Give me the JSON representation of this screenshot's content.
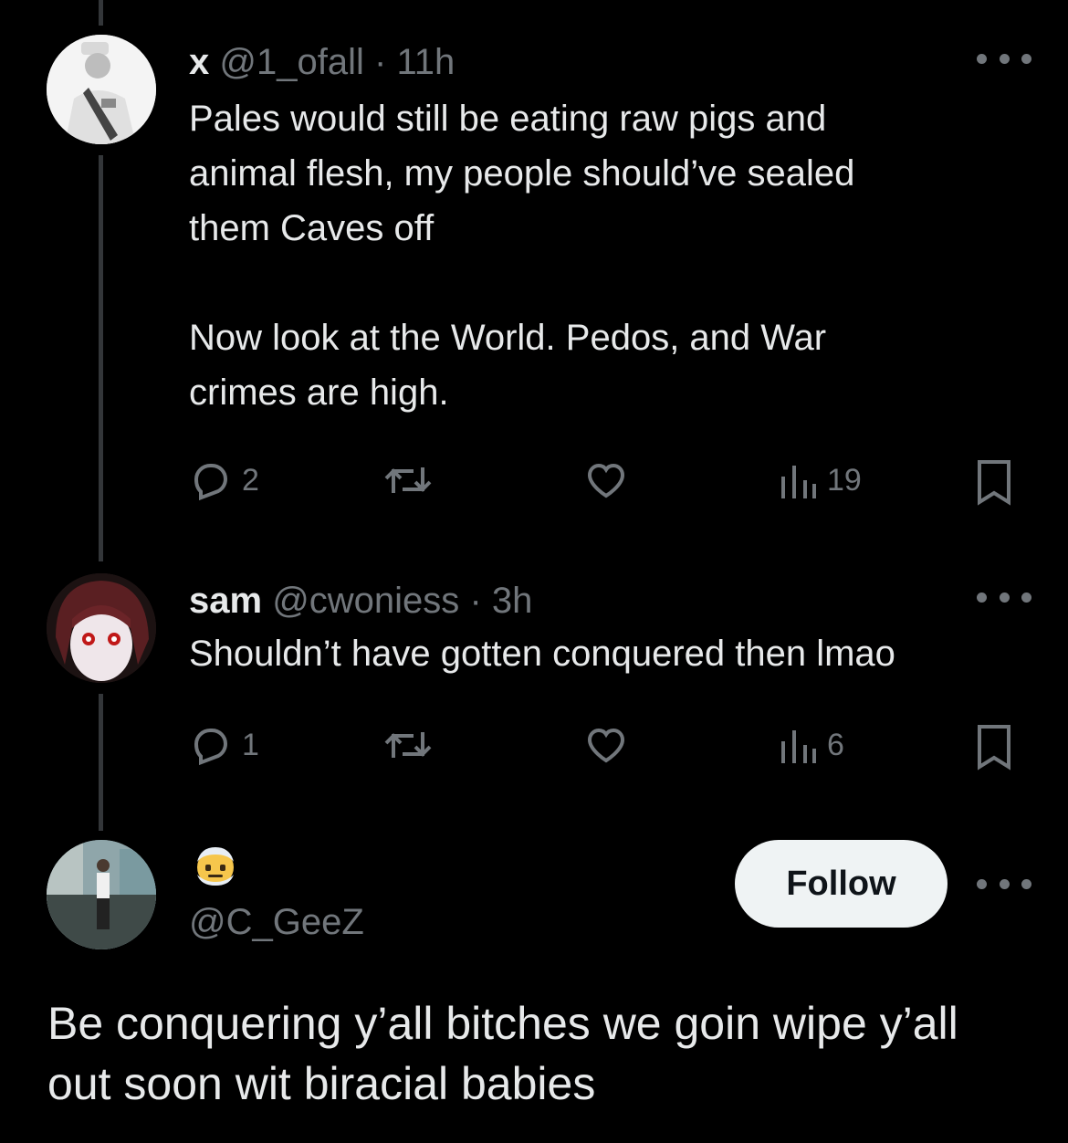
{
  "tweets": [
    {
      "name": "x",
      "handle": "@1_ofall",
      "separator": "·",
      "time": "11h",
      "text": "Pales would still be eating raw pigs and\nanimal flesh, my people should’ve sealed\nthem Caves off\n\nNow look at the World. Pedos, and War\ncrimes are high.",
      "replies": "2",
      "retweets": "",
      "likes": "",
      "views": "19"
    },
    {
      "name": "sam",
      "handle": "@cwoniess",
      "separator": "·",
      "time": "3h",
      "text": "Shouldn’t have gotten conquered then lmao",
      "replies": "1",
      "retweets": "",
      "likes": "",
      "views": "6"
    }
  ],
  "focused_tweet": {
    "display_name_icon": "cold-face-emoji-icon",
    "handle": "@C_GeeZ",
    "follow_label": "Follow",
    "text": "Be conquering y’all bitches we goin wipe y’all\nout soon wit biracial babies"
  },
  "colors": {
    "background": "#000000",
    "text": "#e7e9ea",
    "secondary": "#71767b",
    "thread_line": "#333639",
    "follow_bg": "#eff3f4"
  }
}
